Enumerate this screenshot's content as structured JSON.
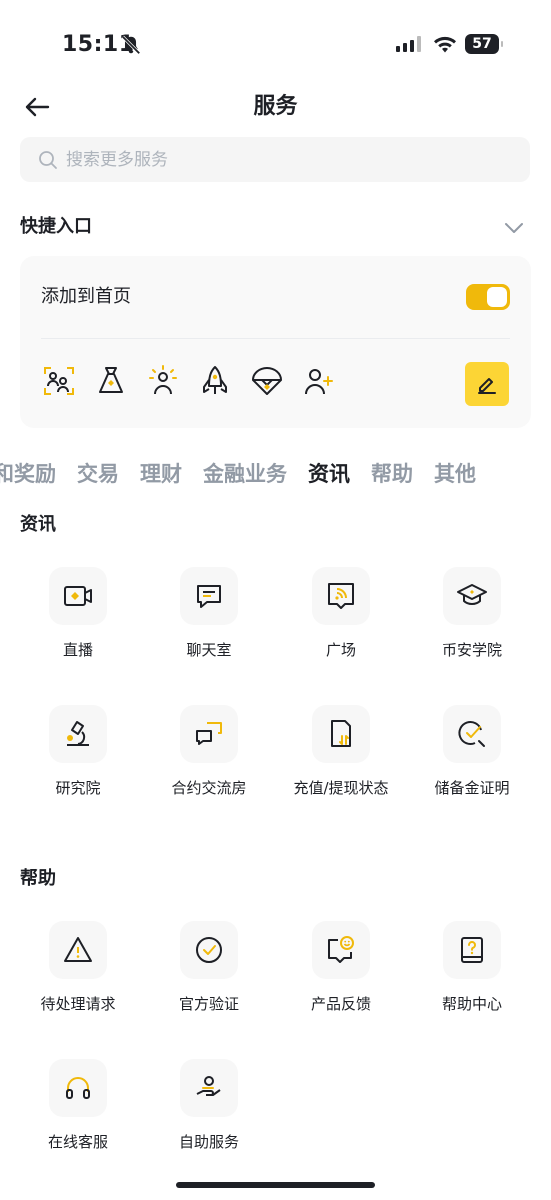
{
  "status_bar": {
    "time": "15:11",
    "battery": "57"
  },
  "header": {
    "title": "服务"
  },
  "search": {
    "placeholder": "搜索更多服务"
  },
  "quick_access": {
    "title": "快捷入口",
    "add_to_home_label": "添加到首页",
    "toggle_on": true,
    "icons": [
      "user-scan-icon",
      "money-bag-icon",
      "sun-person-icon",
      "rocket-icon",
      "parachute-icon",
      "add-user-icon"
    ]
  },
  "tabs": [
    "动和奖励",
    "交易",
    "理财",
    "金融业务",
    "资讯",
    "帮助",
    "其他"
  ],
  "active_tab": "资讯",
  "sections": {
    "news": {
      "title": "资讯",
      "items": [
        {
          "label": "直播",
          "icon": "live-video-icon"
        },
        {
          "label": "聊天室",
          "icon": "chat-icon"
        },
        {
          "label": "广场",
          "icon": "square-feed-icon"
        },
        {
          "label": "币安学院",
          "icon": "graduation-cap-icon"
        },
        {
          "label": "研究院",
          "icon": "microscope-icon"
        },
        {
          "label": "合约交流房",
          "icon": "chat-bubbles-icon"
        },
        {
          "label": "充值/提现状态",
          "icon": "transfer-status-icon"
        },
        {
          "label": "储备金证明",
          "icon": "proof-check-icon"
        }
      ]
    },
    "help": {
      "title": "帮助",
      "items": [
        {
          "label": "待处理请求",
          "icon": "warning-icon"
        },
        {
          "label": "官方验证",
          "icon": "verified-check-icon"
        },
        {
          "label": "产品反馈",
          "icon": "feedback-smile-icon"
        },
        {
          "label": "帮助中心",
          "icon": "help-book-icon"
        },
        {
          "label": "在线客服",
          "icon": "headset-icon"
        },
        {
          "label": "自助服务",
          "icon": "self-service-icon"
        }
      ]
    }
  },
  "colors": {
    "accent": "#F0B90B",
    "accent_light": "#FCD535",
    "text": "#1E2026",
    "muted": "#929AA5"
  }
}
